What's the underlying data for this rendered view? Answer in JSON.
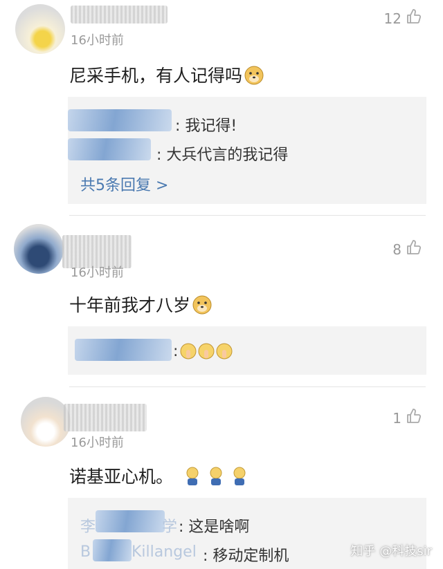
{
  "comments": [
    {
      "time": "16小时前",
      "likes": "12",
      "text": "尼采手机，有人记得吗",
      "emoji": "doge-emoji",
      "replies": [
        {
          "text": ": 我记得!"
        },
        {
          "text": ": 大兵代言的我记得"
        }
      ],
      "more": "共5条回复 >"
    },
    {
      "time": "16小时前",
      "likes": "8",
      "text": "十年前我才八岁",
      "emoji": "doge-emoji",
      "replies": [
        {
          "text": ":"
        }
      ]
    },
    {
      "time": "16小时前",
      "likes": "1",
      "text": "诺基亚心机。",
      "emoji": "sad-sitting-emoji",
      "replies": [
        {
          "name": "李",
          "name_tail": "学",
          "text": ": 这是啥啊"
        },
        {
          "name": "B",
          "name_tail": "Killangel",
          "text": ": 移动定制机"
        }
      ]
    }
  ],
  "watermark": "知乎 @科技sir",
  "colors": {
    "link": "#4a79b0",
    "reply_bg": "#f3f3f3",
    "meta": "#9a9a9a"
  }
}
